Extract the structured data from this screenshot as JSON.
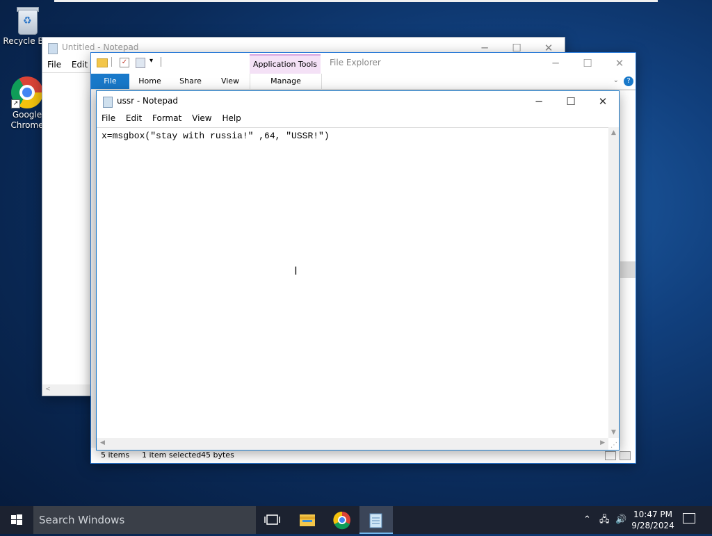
{
  "desktop": {
    "icons": [
      {
        "label": "Recycle Bin",
        "icon": "recycle-bin-icon"
      },
      {
        "label": "Google Chrome",
        "icon": "chrome-icon"
      }
    ]
  },
  "back_notepad": {
    "title": "Untitled - Notepad",
    "menu": [
      "File",
      "Edit"
    ]
  },
  "explorer": {
    "title": "File Explorer",
    "context_group": "Application Tools",
    "tabs": {
      "file": "File",
      "home": "Home",
      "share": "Share",
      "view": "View",
      "manage": "Manage"
    },
    "status": {
      "items": "5 items",
      "selected": "1 item selected",
      "size": "45 bytes"
    },
    "accent": "#1979ca"
  },
  "notepad": {
    "title": "ussr - Notepad",
    "menu": {
      "file": "File",
      "edit": "Edit",
      "format": "Format",
      "view": "View",
      "help": "Help"
    },
    "content": "x=msgbox(\"stay with russia!\" ,64, \"USSR!\")"
  },
  "taskbar": {
    "search_placeholder": "Search Windows",
    "time": "10:47 PM",
    "date": "9/28/2024"
  }
}
